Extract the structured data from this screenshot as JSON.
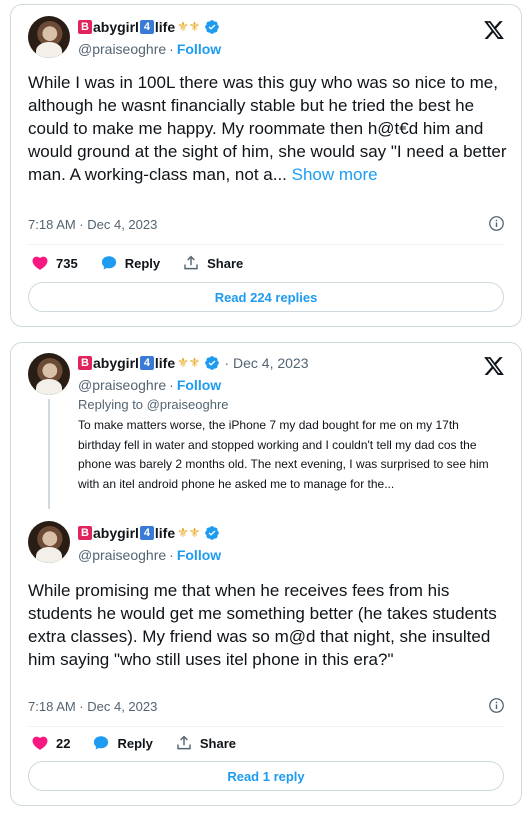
{
  "tweet1": {
    "display_name": {
      "b": "B",
      "part1": "abygirl",
      "four": "4",
      "part2": "life",
      "deco": "⚜⚜"
    },
    "handle": "@praiseoghre",
    "separator": "·",
    "follow_label": "Follow",
    "text": "While I was in 100L there was this guy who was so nice to me, although he wasnt financially stable but he tried the best he could to make me happy. My roommate then h@t€d him and would ground at the sight of him, she would say \"I need a better man. A working-class man, not a...",
    "show_more": "Show more",
    "timestamp": "7:18 AM · Dec 4, 2023",
    "likes": "735",
    "reply_label": "Reply",
    "share_label": "Share",
    "read_replies": "Read 224 replies"
  },
  "tweet2": {
    "display_name": {
      "b": "B",
      "part1": "abygirl",
      "four": "4",
      "part2": "life",
      "deco": "⚜⚜"
    },
    "date": "· Dec 4, 2023",
    "handle": "@praiseoghre",
    "separator": "·",
    "follow_label": "Follow",
    "replying_to": "Replying to @praiseoghre",
    "quoted_text": "To make matters worse, the iPhone 7 my dad bought for me on my 17th birthday fell in water and stopped working and I couldn't tell my dad cos the phone was barely 2 months old. The next evening, I was surprised to see him with an itel android phone he asked me to manage for the..."
  },
  "tweet3": {
    "display_name": {
      "b": "B",
      "part1": "abygirl",
      "four": "4",
      "part2": "life",
      "deco": "⚜⚜"
    },
    "handle": "@praiseoghre",
    "separator": "·",
    "follow_label": "Follow",
    "text": "While promising me that when he receives fees from his students he would get me something better (he takes students extra classes). My friend was so m@d that night, she insulted him saying \"who still uses itel phone in this era?\"",
    "timestamp": "7:18 AM · Dec 4, 2023",
    "likes": "22",
    "reply_label": "Reply",
    "share_label": "Share",
    "read_replies": "Read 1 reply"
  },
  "colors": {
    "accent": "#1d9bf0",
    "like": "#f91880",
    "text": "#0f1419",
    "muted": "#536471",
    "border": "#cfd9de"
  },
  "icons": [
    "x-logo-icon",
    "verified-badge-icon",
    "info-icon",
    "heart-icon",
    "reply-bubble-icon",
    "share-icon"
  ]
}
